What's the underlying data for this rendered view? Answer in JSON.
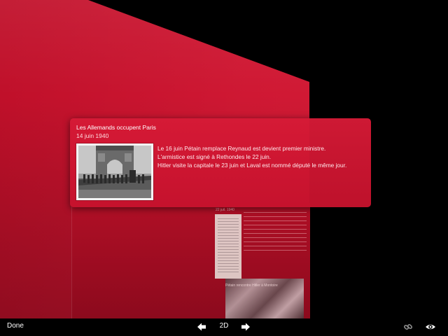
{
  "event": {
    "title": "Les Allemands occupent Paris",
    "date": "14 juin 1940",
    "lines": [
      "Le 16 juin Pétain remplace Reynaud est devient premier ministre.",
      "L'armistice est signé à Rethondes le 22 juin.",
      "Hitler visite la capitale le 23 juin et Laval est nommé député le même jour."
    ]
  },
  "background_timeline": {
    "card_title": "22 juil. 1940",
    "card2_title": "Pétain rencontre Hitler à Montoire"
  },
  "toolbar": {
    "done_label": "Done",
    "mode_label": "2D",
    "prev_icon": "arrow-left-icon",
    "next_icon": "arrow-right-icon",
    "link_icon": "link-icon",
    "view_icon": "eye-icon"
  },
  "colors": {
    "panel_red": "#cf1833",
    "card_red": "#d61a36",
    "background": "#000000"
  }
}
